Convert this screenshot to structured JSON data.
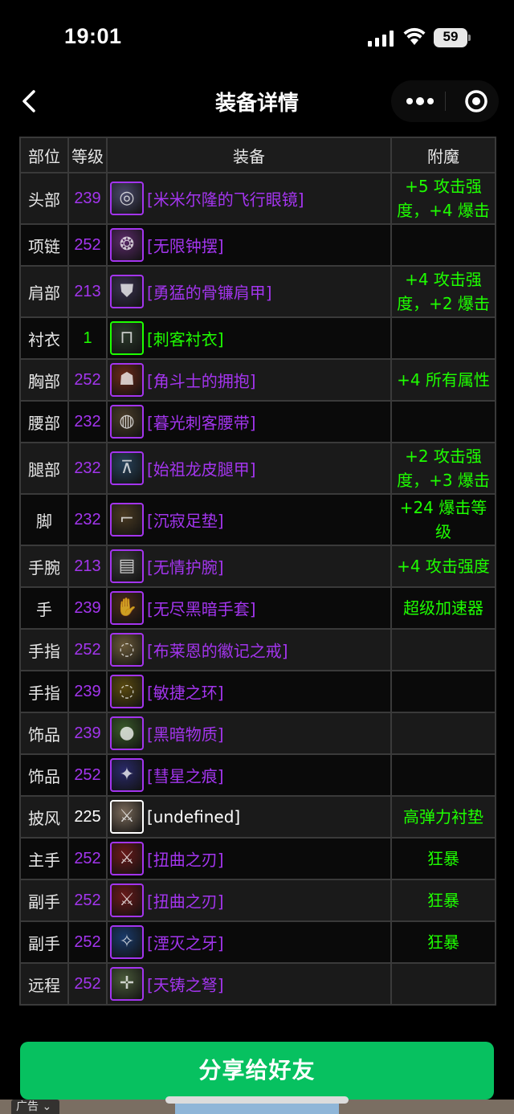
{
  "status": {
    "time": "19:01",
    "battery": "59"
  },
  "nav": {
    "title": "装备详情",
    "back_icon": "chevron-left-icon",
    "more_icon": "more-dots-icon",
    "target_icon": "target-icon"
  },
  "table": {
    "headers": [
      "部位",
      "等级",
      "装备",
      "附魔"
    ],
    "rows": [
      {
        "slot": "头部",
        "ilvl": "239",
        "name": "[米米尔隆的飞行眼镜]",
        "ench": "+5 攻击强度，+4 爆击",
        "quality": "epic",
        "icon": "goggles-icon"
      },
      {
        "slot": "项链",
        "ilvl": "252",
        "name": "[无限钟摆]",
        "ench": "",
        "quality": "epic",
        "icon": "necklace-icon"
      },
      {
        "slot": "肩部",
        "ilvl": "213",
        "name": "[勇猛的骨镰肩甲]",
        "ench": "+4 攻击强度，+2 爆击",
        "quality": "epic",
        "icon": "shoulder-armor-icon"
      },
      {
        "slot": "衬衣",
        "ilvl": "1",
        "name": "[刺客衬衣]",
        "ench": "",
        "quality": "uncommon",
        "icon": "shirt-icon"
      },
      {
        "slot": "胸部",
        "ilvl": "252",
        "name": "[角斗士的拥抱]",
        "ench": "+4 所有属性",
        "quality": "epic",
        "icon": "chest-armor-icon"
      },
      {
        "slot": "腰部",
        "ilvl": "232",
        "name": "[暮光刺客腰带]",
        "ench": "",
        "quality": "epic",
        "icon": "belt-icon"
      },
      {
        "slot": "腿部",
        "ilvl": "232",
        "name": "[始祖龙皮腿甲]",
        "ench": "+2 攻击强度，+3 爆击",
        "quality": "epic",
        "icon": "leg-armor-icon"
      },
      {
        "slot": "脚",
        "ilvl": "232",
        "name": "[沉寂足垫]",
        "ench": "+24 爆击等级",
        "quality": "epic",
        "icon": "boots-icon"
      },
      {
        "slot": "手腕",
        "ilvl": "213",
        "name": "[无情护腕]",
        "ench": "+4 攻击强度",
        "quality": "epic",
        "icon": "bracer-icon"
      },
      {
        "slot": "手",
        "ilvl": "239",
        "name": "[无尽黑暗手套]",
        "ench": "超级加速器",
        "quality": "epic",
        "icon": "gloves-icon"
      },
      {
        "slot": "手指",
        "ilvl": "252",
        "name": "[布莱恩的徽记之戒]",
        "ench": "",
        "quality": "epic",
        "icon": "ring-icon"
      },
      {
        "slot": "手指",
        "ilvl": "239",
        "name": "[敏捷之环]",
        "ench": "",
        "quality": "epic",
        "icon": "ring-icon"
      },
      {
        "slot": "饰品",
        "ilvl": "239",
        "name": "[黑暗物质]",
        "ench": "",
        "quality": "epic",
        "icon": "trinket-icon"
      },
      {
        "slot": "饰品",
        "ilvl": "252",
        "name": "[彗星之痕]",
        "ench": "",
        "quality": "epic",
        "icon": "comet-trinket-icon"
      },
      {
        "slot": "披风",
        "ilvl": "225",
        "name": "[undefined]",
        "ench": "高弹力衬垫",
        "quality": "common",
        "icon": "cloak-icon"
      },
      {
        "slot": "主手",
        "ilvl": "252",
        "name": "[扭曲之刃]",
        "ench": "狂暴",
        "quality": "epic",
        "icon": "dagger-icon"
      },
      {
        "slot": "副手",
        "ilvl": "252",
        "name": "[扭曲之刃]",
        "ench": "狂暴",
        "quality": "epic",
        "icon": "dagger-icon"
      },
      {
        "slot": "副手",
        "ilvl": "252",
        "name": "[湮灭之牙]",
        "ench": "狂暴",
        "quality": "epic",
        "icon": "fang-dagger-icon"
      },
      {
        "slot": "远程",
        "ilvl": "252",
        "name": "[天铸之弩]",
        "ench": "",
        "quality": "epic",
        "icon": "crossbow-icon"
      }
    ]
  },
  "share_button": "分享给好友",
  "ad_label": "广告",
  "colors": {
    "epic": "#a335ee",
    "uncommon": "#1eff00",
    "common": "#ffffff",
    "enchant": "#1eff00",
    "share": "#07c160"
  }
}
